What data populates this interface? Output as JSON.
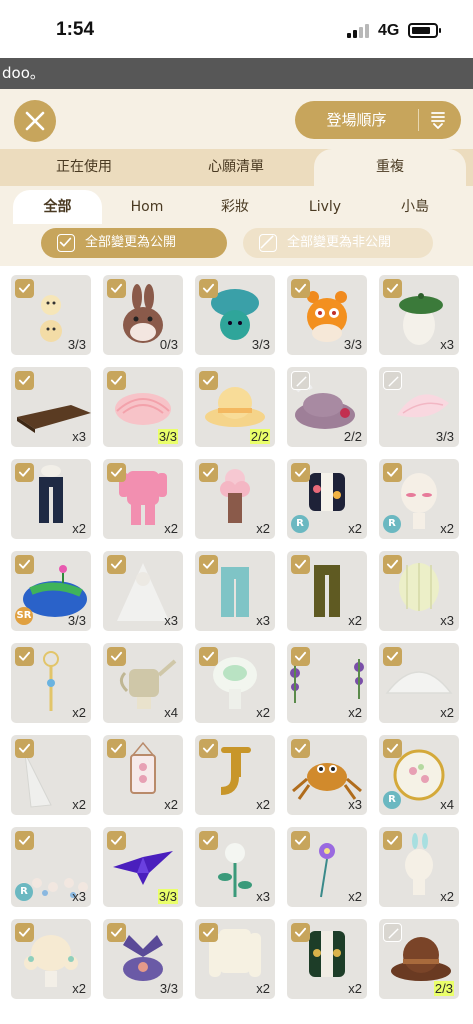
{
  "status": {
    "time": "1:54",
    "network": "4G"
  },
  "banner": {
    "text": "doo。"
  },
  "toolbar": {
    "sort_label": "登場順序"
  },
  "tabs": [
    {
      "label": "正在使用",
      "active": false
    },
    {
      "label": "心願清單",
      "active": false
    },
    {
      "label": "重複",
      "active": true
    }
  ],
  "subtabs": [
    {
      "label": "全部",
      "active": true
    },
    {
      "label": "Hom",
      "active": false
    },
    {
      "label": "彩妝",
      "active": false
    },
    {
      "label": "Livly",
      "active": false
    },
    {
      "label": "小島",
      "active": false
    }
  ],
  "bulk": {
    "make_public": "全部變更為公開",
    "make_private": "全部變更為非公開"
  },
  "colors": {
    "gold": "#c7a55c",
    "highlight": "#eaff6a",
    "rare_badge": "#6bb8c1",
    "sr_badge": "#e0a040"
  },
  "items": [
    {
      "icon": "egg-chicks-icon",
      "count": "3/3",
      "checked": true
    },
    {
      "icon": "bunny-icon",
      "count": "0/3",
      "checked": true
    },
    {
      "icon": "mushroom-creature-icon",
      "count": "3/3",
      "checked": true
    },
    {
      "icon": "orange-hamster-icon",
      "count": "3/3",
      "checked": true
    },
    {
      "icon": "green-beret-icon",
      "count": "x3",
      "checked": true
    },
    {
      "icon": "wood-plank-icon",
      "count": "x3",
      "checked": true
    },
    {
      "icon": "pink-shell-icon",
      "count": "3/3",
      "checked": true,
      "highlight": true
    },
    {
      "icon": "yellow-hat-icon",
      "count": "2/2",
      "checked": true,
      "highlight": true
    },
    {
      "icon": "purple-hat-icon",
      "count": "2/2",
      "checked": false
    },
    {
      "icon": "petal-icon",
      "count": "3/3",
      "checked": false
    },
    {
      "icon": "navy-pants-icon",
      "count": "x2",
      "checked": true
    },
    {
      "icon": "pink-jersey-icon",
      "count": "x2",
      "checked": true
    },
    {
      "icon": "flower-outfit-icon",
      "count": "x2",
      "checked": true
    },
    {
      "icon": "jacket-icon",
      "count": "x2",
      "checked": true,
      "badge": "R"
    },
    {
      "icon": "blush-face-icon",
      "count": "x2",
      "checked": true,
      "badge": "R"
    },
    {
      "icon": "livly-globe-hat-icon",
      "count": "3/3",
      "checked": true,
      "badge": "SR"
    },
    {
      "icon": "ghost-veil-icon",
      "count": "x3",
      "checked": true
    },
    {
      "icon": "jeans-icon",
      "count": "x3",
      "checked": true
    },
    {
      "icon": "olive-pants-icon",
      "count": "x2",
      "checked": true
    },
    {
      "icon": "lantern-skirt-icon",
      "count": "x3",
      "checked": true
    },
    {
      "icon": "wand-icon",
      "count": "x2",
      "checked": true
    },
    {
      "icon": "watering-can-icon",
      "count": "x4",
      "checked": true
    },
    {
      "icon": "glow-mushroom-icon",
      "count": "x2",
      "checked": true
    },
    {
      "icon": "vine-flowers-icon",
      "count": "x2",
      "checked": true
    },
    {
      "icon": "glass-dome-icon",
      "count": "x2",
      "checked": true
    },
    {
      "icon": "glass-shard-icon",
      "count": "x2",
      "checked": true
    },
    {
      "icon": "pressed-flower-frame-icon",
      "count": "x2",
      "checked": true
    },
    {
      "icon": "faucet-icon",
      "count": "x2",
      "checked": true
    },
    {
      "icon": "spider-icon",
      "count": "x3",
      "checked": true
    },
    {
      "icon": "flower-wreath-icon",
      "count": "x4",
      "checked": true,
      "badge": "R"
    },
    {
      "icon": "mushroom-field-icon",
      "count": "x3",
      "checked": true,
      "badge": "R"
    },
    {
      "icon": "paper-crane-icon",
      "count": "3/3",
      "checked": true,
      "highlight": true
    },
    {
      "icon": "white-rose-icon",
      "count": "x3",
      "checked": true
    },
    {
      "icon": "purple-flower-icon",
      "count": "x2",
      "checked": true
    },
    {
      "icon": "bunny-ear-clip-icon",
      "count": "x2",
      "checked": true
    },
    {
      "icon": "cream-hair-icon",
      "count": "x2",
      "checked": true
    },
    {
      "icon": "purple-headband-icon",
      "count": "3/3",
      "checked": true
    },
    {
      "icon": "cream-sweater-icon",
      "count": "x2",
      "checked": true
    },
    {
      "icon": "green-vest-icon",
      "count": "x2",
      "checked": true
    },
    {
      "icon": "brown-bowler-hat-icon",
      "count": "2/3",
      "checked": false,
      "highlight": true
    }
  ]
}
